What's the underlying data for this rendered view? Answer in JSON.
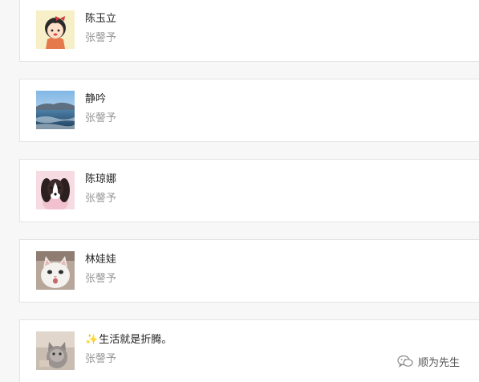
{
  "contacts": [
    {
      "name": "陈玉立",
      "subtitle": "张謦予",
      "avatar": "cartoon-girl-avatar"
    },
    {
      "name": "静吟",
      "subtitle": "张謦予",
      "avatar": "seascape-avatar"
    },
    {
      "name": "陈琼娜",
      "subtitle": "张謦予",
      "avatar": "dog-avatar"
    },
    {
      "name": "林娃娃",
      "subtitle": "张謦予",
      "avatar": "white-cat-avatar"
    },
    {
      "name": "生活就是折腾。",
      "name_prefix": "✨",
      "subtitle": "张謦予",
      "avatar": "cat-photo-avatar"
    }
  ],
  "watermark": {
    "label": "顺为先生",
    "icon": "wechat-icon"
  }
}
